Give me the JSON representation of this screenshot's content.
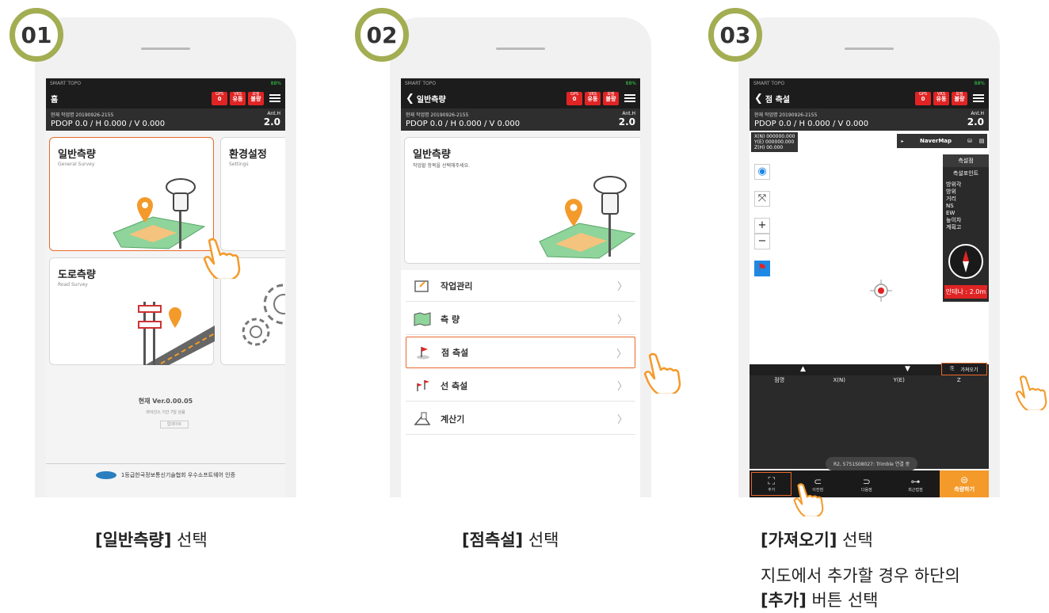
{
  "steps": [
    {
      "badge": "01",
      "caption_bold": "[일반측량]",
      "caption_rest": " 선택",
      "screen": {
        "status_app": "SMART TOPO",
        "battery": "88%",
        "title": "홈",
        "pills": [
          {
            "top": "GPS",
            "val": "0"
          },
          {
            "top": "VRS",
            "val": "유동"
          },
          {
            "top": "보정",
            "val": "불량"
          }
        ],
        "work_label": "현재 작업명 20190926-2155",
        "pdop": "PDOP 0.0 / H 0.000 / V 0.000",
        "anth_label": "Ant.H",
        "anth_value": "2.0",
        "cards": [
          {
            "title": "일반측량",
            "sub": "General Survey"
          },
          {
            "title": "환경설정",
            "sub": "Settings"
          },
          {
            "title": "도로측량",
            "sub": "Road Survey"
          }
        ],
        "version": "현재 Ver.0.00.05",
        "license": "라이선스 기간 7일 남음",
        "update_btn": "업데이트",
        "cert": "1등급한국정보통신기술협회 우수소프트웨어 인증"
      }
    },
    {
      "badge": "02",
      "caption_bold": "[점측설]",
      "caption_rest": " 선택",
      "screen": {
        "status_app": "SMART TOPO",
        "battery": "88%",
        "title": "일반측량",
        "pills": [
          {
            "top": "GPS",
            "val": "0"
          },
          {
            "top": "VRS",
            "val": "유동"
          },
          {
            "top": "보정",
            "val": "불량"
          }
        ],
        "work_label": "현재 작업명 20190926-2155",
        "pdop": "PDOP 0.0 / H 0.000 / V 0.000",
        "anth_label": "Ant.H",
        "anth_value": "2.0",
        "banner_title": "일반측량",
        "banner_sub": "작업할 항목을 선택해주세요.",
        "menu": [
          "작업관리",
          "측 량",
          "점 측설",
          "선 측설",
          "계산기"
        ]
      }
    },
    {
      "badge": "03",
      "caption_bold": "[가져오기]",
      "caption_rest": " 선택",
      "sub_line1": "지도에서 추가할 경우 하단의",
      "sub_line2_bold": "[추가]",
      "sub_line2_rest": " 버튼 선택",
      "screen": {
        "status_app": "SMART TOPO",
        "battery": "88%",
        "title": "점 측설",
        "pills": [
          {
            "top": "GPS",
            "val": "0"
          },
          {
            "top": "VRS",
            "val": "유동"
          },
          {
            "top": "보정",
            "val": "불량"
          }
        ],
        "work_label": "현재 작업명 20190926-2155",
        "pdop": "PDOP 0.0 / H 0.000 / V 0.000",
        "anth_label": "Ant.H",
        "anth_value": "2.0",
        "coords": [
          "X(N) 000000.000",
          "Y(E) 000000.000",
          "Z(H) 00.000"
        ],
        "map_provider": "NaverMap",
        "panel_title1": "측설점",
        "panel_title2": "측설포인트",
        "panel_items": [
          "방위각",
          "방위",
          "거리",
          "NS",
          "EW",
          "높이차",
          "계획고"
        ],
        "antenna": "안테나 : 2.0m",
        "import_btn": "가져오기",
        "columns": [
          "점명",
          "X(N)",
          "Y(E)",
          "Z"
        ],
        "toast": "R2, 5751S08027: Trimble 연결 중",
        "bottom": [
          "추가",
          "이전점",
          "다음점",
          "최근접점"
        ],
        "measure_btn": "측량하기"
      }
    }
  ],
  "colors": {
    "badge_ring": "#a3ad52",
    "highlight": "#ea6a2b",
    "status_red": "#e02424",
    "accent_orange": "#f39a2b",
    "map_blue": "#1e88e5"
  }
}
